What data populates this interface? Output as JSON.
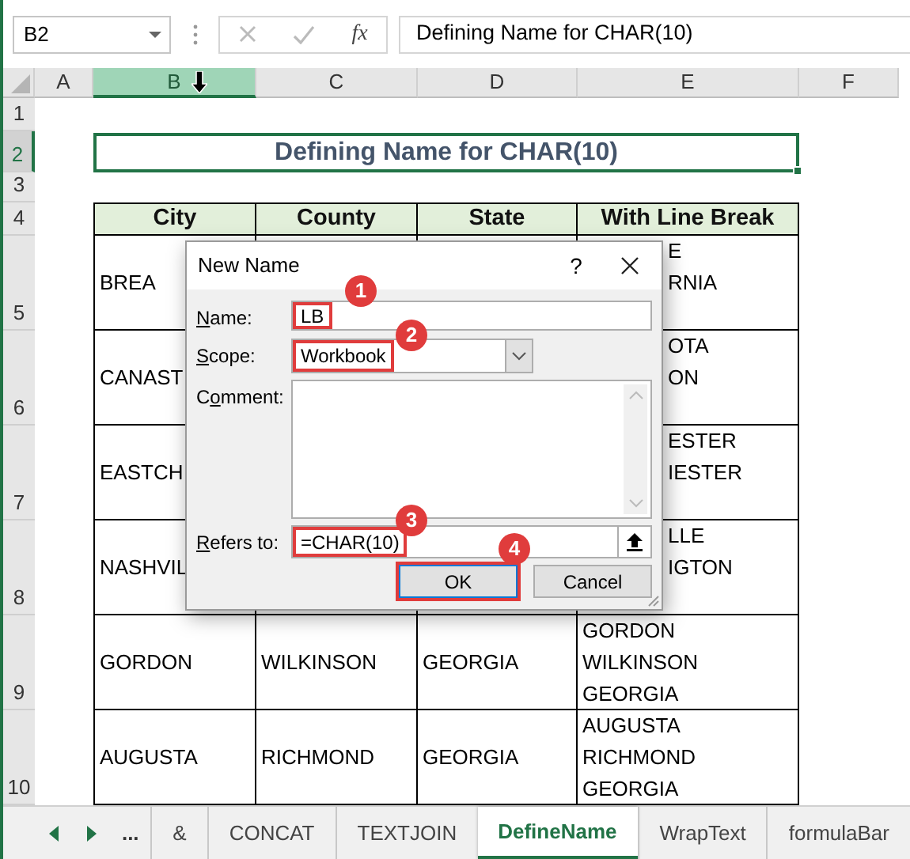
{
  "formula_bar": {
    "name_box": "B2",
    "fx": "fx",
    "formula": "Defining Name for CHAR(10)"
  },
  "column_headers": [
    {
      "label": "A",
      "selected": false
    },
    {
      "label": "B",
      "selected": true
    },
    {
      "label": "C",
      "selected": false
    },
    {
      "label": "D",
      "selected": false
    },
    {
      "label": "E",
      "selected": false
    },
    {
      "label": "F",
      "selected": false
    }
  ],
  "row_headers": [
    {
      "label": "1",
      "selected": false
    },
    {
      "label": "2",
      "selected": true
    },
    {
      "label": "3",
      "selected": false
    },
    {
      "label": "4",
      "selected": false
    },
    {
      "label": "5",
      "selected": false
    },
    {
      "label": "6",
      "selected": false
    },
    {
      "label": "7",
      "selected": false
    },
    {
      "label": "8",
      "selected": false
    },
    {
      "label": "9",
      "selected": false
    },
    {
      "label": "10",
      "selected": false
    }
  ],
  "title_cell": {
    "text": "Defining Name for CHAR(10)",
    "selected": true
  },
  "table": {
    "columns": [
      "City",
      "County",
      "State",
      "With Line Break"
    ],
    "rows": [
      {
        "city": "BREA",
        "line_break": [
          "E",
          "RNIA"
        ],
        "covered": true
      },
      {
        "city": "CANAST",
        "line_break": [
          "OTA",
          "ON"
        ],
        "covered": true
      },
      {
        "city": "EASTCH",
        "line_break": [
          "ESTER",
          "IESTER"
        ],
        "covered": true
      },
      {
        "city": "NASHVIL",
        "line_break": [
          "LLE",
          "IGTON"
        ],
        "covered": true
      },
      {
        "city": "GORDON",
        "county": "WILKINSON",
        "state": "GEORGIA",
        "line_break": [
          "GORDON",
          "WILKINSON",
          "GEORGIA"
        ],
        "covered": false
      },
      {
        "city": "AUGUSTA",
        "county": "RICHMOND",
        "state": "GEORGIA",
        "line_break": [
          "AUGUSTA",
          "RICHMOND",
          "GEORGIA"
        ],
        "covered": false
      }
    ]
  },
  "dialog": {
    "title": "New Name",
    "help": "?",
    "fields": [
      {
        "kind": "text",
        "label": [
          {
            "text": "N",
            "underline": true
          },
          {
            "text": "ame:",
            "underline": false
          }
        ],
        "value": "LB",
        "callout": "1"
      },
      {
        "kind": "select",
        "label": [
          {
            "text": "S",
            "underline": true
          },
          {
            "text": "cope:",
            "underline": false
          }
        ],
        "value": "Workbook",
        "callout": "2"
      },
      {
        "kind": "textarea",
        "label": [
          {
            "text": "C",
            "underline": false
          },
          {
            "text": "o",
            "underline": true
          },
          {
            "text": "mment:",
            "underline": false
          }
        ]
      },
      {
        "kind": "reference",
        "label": [
          {
            "text": "R",
            "underline": true
          },
          {
            "text": "efers to:",
            "underline": false
          }
        ],
        "value": "=CHAR(10)",
        "callout": "3"
      }
    ],
    "buttons": [
      {
        "label": "OK",
        "default": true,
        "highlighted": true,
        "callout": "4"
      },
      {
        "label": "Cancel",
        "default": false,
        "highlighted": false
      }
    ]
  },
  "sheet_tabs": {
    "more": "...",
    "tabs": [
      {
        "label": "&",
        "selected": false
      },
      {
        "label": "CONCAT",
        "selected": false
      },
      {
        "label": "TEXTJOIN",
        "selected": false
      },
      {
        "label": "DefineName",
        "selected": true
      },
      {
        "label": "WrapText",
        "selected": false
      },
      {
        "label": "formulaBar",
        "selected": false
      }
    ]
  }
}
